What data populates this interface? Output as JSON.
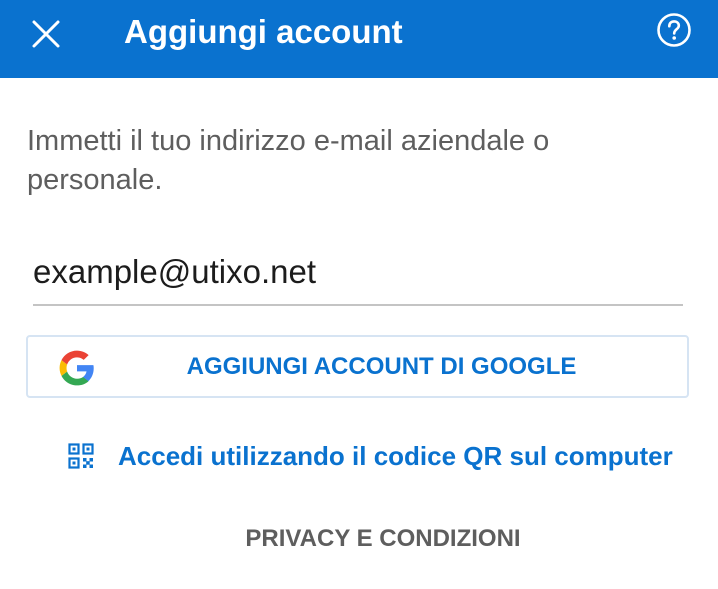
{
  "header": {
    "title": "Aggiungi account",
    "close_icon": "close-icon",
    "help_icon": "help-icon",
    "background_color": "#0a72cf"
  },
  "main": {
    "instruction": "Immetti il tuo indirizzo e-mail aziendale o personale.",
    "email_value": "example@utixo.net",
    "google_button_label": "AGGIUNGI ACCOUNT DI GOOGLE",
    "google_icon": "google-logo-icon",
    "qr_link_label": "Accedi utilizzando il codice QR sul computer",
    "qr_icon": "qr-code-icon",
    "privacy_link_label": "PRIVACY E CONDIZIONI",
    "accent_color": "#0a72cf"
  }
}
